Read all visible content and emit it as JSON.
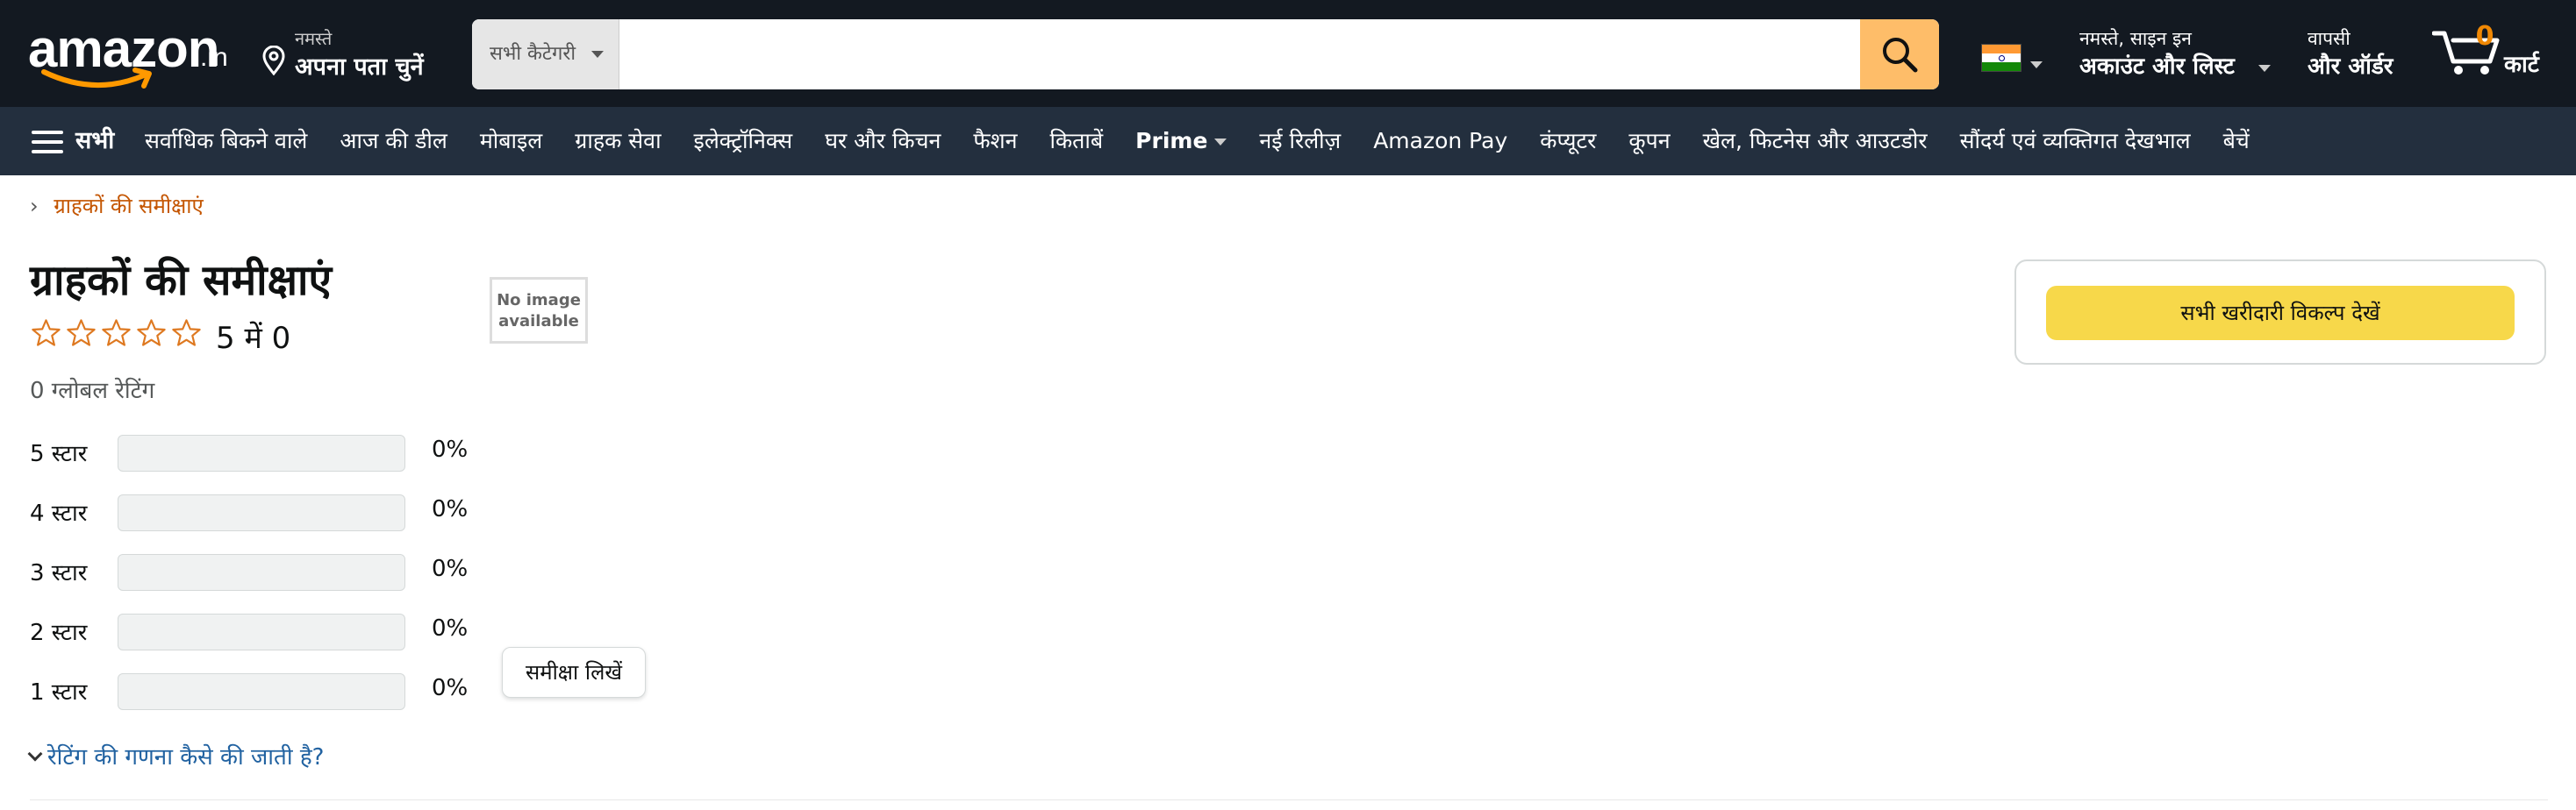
{
  "header": {
    "logo": {
      "word": "amazon",
      "tld": ".in"
    },
    "deliver": {
      "greeting": "नमस्ते",
      "address_prompt": "अपना पता चुनें"
    },
    "search": {
      "category": "सभी कैटेगरी",
      "placeholder": "",
      "value": ""
    },
    "locale": {
      "flag": "India"
    },
    "account": {
      "line1": "नमस्ते, साइन इन",
      "line2": "अकाउंट और लिस्ट"
    },
    "orders": {
      "line1": "वापसी",
      "line2": "और ऑर्डर"
    },
    "cart": {
      "count": "0",
      "label": "कार्ट"
    }
  },
  "nav": {
    "all_label": "सभी",
    "items": [
      "सर्वाधिक बिकने वाले",
      "आज की डील",
      "मोबाइल",
      "ग्राहक सेवा",
      "इलेक्ट्रॉनिक्स",
      "घर और किचन",
      "फैशन",
      "किताबें",
      "Prime",
      "नई रिलीज़",
      "Amazon Pay",
      "कंप्यूटर",
      "कूपन",
      "खेल, फिटनेस और आउटडोर",
      "सौंदर्य एवं व्यक्तिगत देखभाल",
      "बेचें"
    ]
  },
  "breadcrumb": {
    "separator": "›",
    "link": "ग्राहकों की समीक्षाएं"
  },
  "reviews": {
    "title": "ग्राहकों की समीक्षाएं",
    "star_rating": 0,
    "out_of": "5 में 0",
    "global_ratings": "0 ग्लोबल रेटिंग",
    "no_image": {
      "line1": "No image",
      "line2": "available"
    },
    "histogram": [
      {
        "label": "5 स्टार",
        "percent": 0,
        "percent_text": "0%"
      },
      {
        "label": "4 स्टार",
        "percent": 0,
        "percent_text": "0%"
      },
      {
        "label": "3 स्टार",
        "percent": 0,
        "percent_text": "0%"
      },
      {
        "label": "2 स्टार",
        "percent": 0,
        "percent_text": "0%"
      },
      {
        "label": "1 स्टार",
        "percent": 0,
        "percent_text": "0%"
      }
    ],
    "write_review_label": "समीक्षा लिखें",
    "how_calculated_label": "रेटिंग की गणना कैसे की जाती है?"
  },
  "buybox": {
    "button_label": "सभी खरीदारी विकल्प देखें"
  },
  "colors": {
    "header_bg": "#131921",
    "nav_bg": "#232f3e",
    "search_button": "#febd69",
    "cart_count": "#f08804",
    "breadcrumb_link": "#c45500",
    "star_outline": "#de7921",
    "link_blue": "#2162a1",
    "buy_button": "#f7d84a"
  },
  "icons": {
    "location": "map-pin-icon",
    "search": "magnifier-icon",
    "menu": "hamburger-icon",
    "cart": "cart-icon",
    "star": "star-outline-icon"
  }
}
